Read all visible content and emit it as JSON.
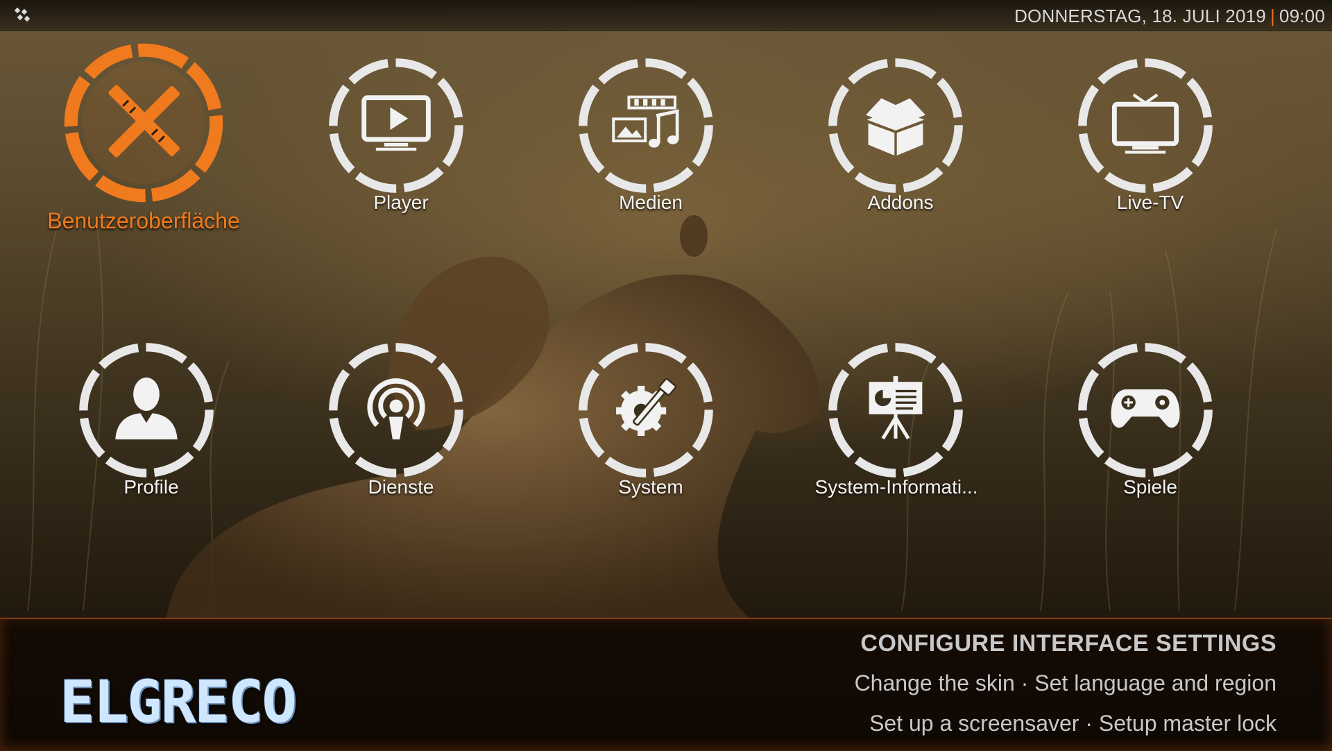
{
  "topbar": {
    "date": "DONNERSTAG, 18. JULI 2019",
    "separator": "|",
    "time": "09:00"
  },
  "menu": {
    "items": [
      {
        "label": "Benutzeroberfläche",
        "icon": "ui-settings-icon",
        "focused": true
      },
      {
        "label": "Player",
        "icon": "player-icon"
      },
      {
        "label": "Medien",
        "icon": "media-icon"
      },
      {
        "label": "Addons",
        "icon": "addons-box-icon"
      },
      {
        "label": "Live-TV",
        "icon": "tv-icon"
      },
      {
        "label": "Profile",
        "icon": "profile-icon"
      },
      {
        "label": "Dienste",
        "icon": "services-icon"
      },
      {
        "label": "System",
        "icon": "system-gear-icon"
      },
      {
        "label": "System-Informati...",
        "icon": "system-info-icon"
      },
      {
        "label": "Spiele",
        "icon": "gamepad-icon"
      }
    ]
  },
  "description": {
    "title": "CONFIGURE INTERFACE SETTINGS",
    "line1": "Change the skin · Set language and region",
    "line2": "Set up a screensaver · Setup master lock"
  },
  "brand": {
    "text": "ELGRECO"
  },
  "colors": {
    "accent": "#f07a1e",
    "ring": "#e8e8e8",
    "text": "#f4f4f4"
  }
}
